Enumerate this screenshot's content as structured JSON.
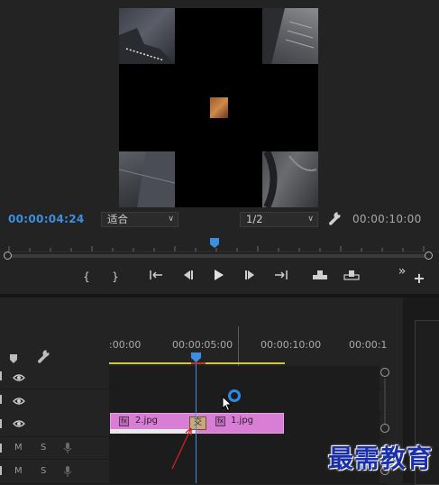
{
  "program_monitor": {
    "current_timecode": "00:00:04:24",
    "duration_timecode": "00:00:10:00",
    "fit_dropdown": {
      "selected": "适合"
    },
    "resolution_dropdown": {
      "selected": "1/2"
    },
    "transport": {
      "mark_in": "{",
      "mark_out": "}",
      "go_to_in": "{←",
      "step_back": "◀|",
      "play": "▶",
      "step_forward": "|▶",
      "go_to_out": "→}",
      "insert": "insert",
      "overwrite": "overwrite",
      "more": "»",
      "add": "+"
    }
  },
  "timeline": {
    "ruler_labels": [
      ":00:00",
      "00:00:05:00",
      "00:00:10:00",
      "00:00:1"
    ],
    "tracks": [
      {
        "id": "v3",
        "type": "video"
      },
      {
        "id": "v2",
        "type": "video"
      },
      {
        "id": "v1",
        "type": "video"
      },
      {
        "id": "a1",
        "type": "audio",
        "mute": "M",
        "solo": "S"
      },
      {
        "id": "a2",
        "type": "audio",
        "mute": "M",
        "solo": "S"
      }
    ],
    "clips": [
      {
        "name": "2.jpg",
        "fx": "fx"
      },
      {
        "name": "1.jpg",
        "fx": "fx"
      }
    ],
    "transition_label": "交"
  },
  "watermark": "最需教育",
  "colors": {
    "accent_blue": "#3c8fe0",
    "clip_pink": "#d87ed4",
    "work_area_yellow": "#d4c832",
    "arrow_red": "#d42020"
  }
}
